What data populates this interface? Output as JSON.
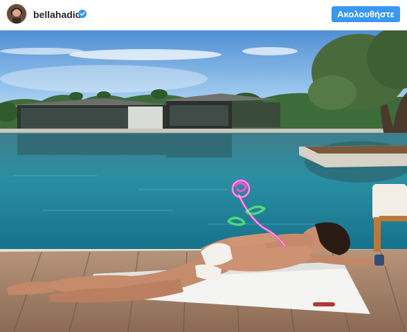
{
  "header": {
    "username": "bellahadid",
    "verified": true,
    "follow_label": "Ακολουθήστε",
    "icons": [
      "avatar",
      "verified-badge-icon"
    ]
  },
  "colors": {
    "follow_button": "#3897f0",
    "verified": "#3897f0",
    "pool_water": "#1f7a8c",
    "sky": "#79b2e3",
    "deck": "#a07d64",
    "sticker_neon": "#ff4dd2"
  },
  "photo": {
    "sticker": "neon-rose-sticker"
  }
}
